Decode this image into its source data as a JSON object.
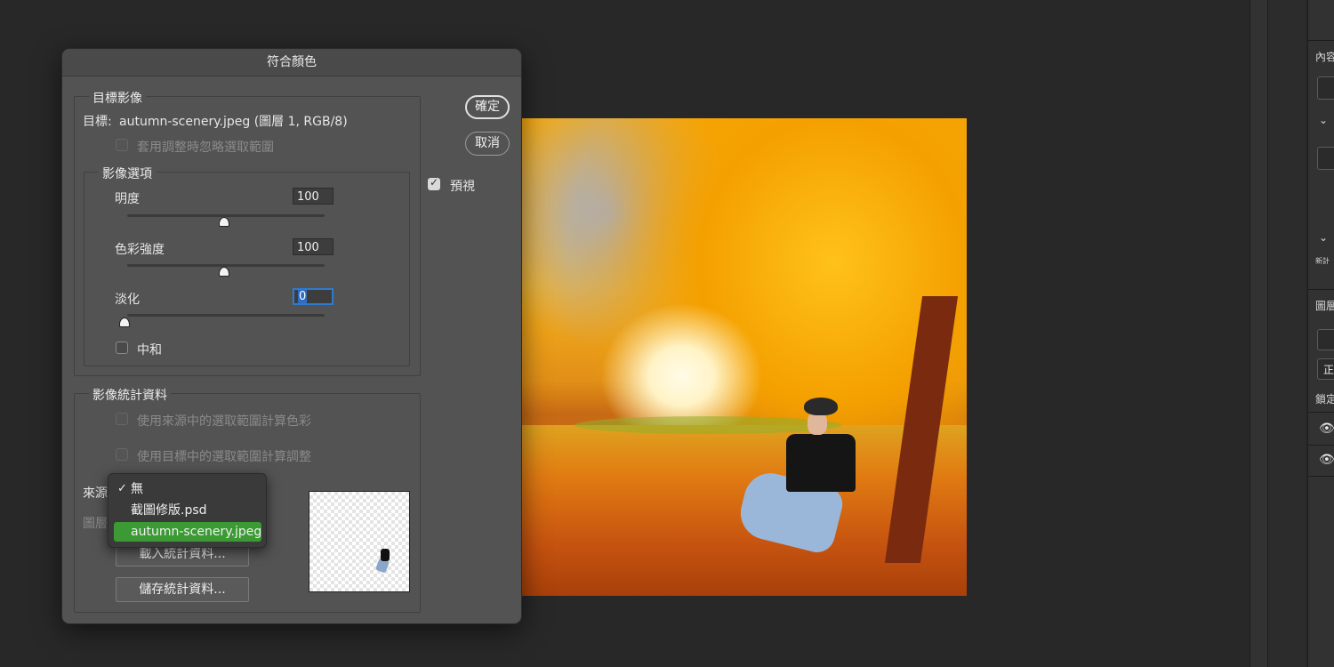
{
  "dialog": {
    "title": "符合顏色",
    "target_image": {
      "group_title": "目標影像",
      "target_label": "目標:",
      "target_value": "autumn-scenery.jpeg (圖層 1, RGB/8)",
      "ignore_selection_label": "套用調整時忽略選取範圍"
    },
    "image_options": {
      "group_title": "影像選項",
      "luminance_label": "明度",
      "luminance_value": "100",
      "color_intensity_label": "色彩強度",
      "color_intensity_value": "100",
      "fade_label": "淡化",
      "fade_value": "0",
      "neutralize_label": "中和",
      "luminance_level": 0.5,
      "color_intensity_level": 0.5,
      "fade_level": 0.0
    },
    "image_statistics": {
      "group_title": "影像統計資料",
      "use_source_selection_label": "使用來源中的選取範圍計算色彩",
      "use_target_selection_label": "使用目標中的選取範圍計算調整",
      "source_label": "來源",
      "layer_label": "圖層",
      "load_stats_label": "載入統計資料...",
      "save_stats_label": "儲存統計資料..."
    },
    "ok_label": "確定",
    "cancel_label": "取消",
    "preview_label": "預視",
    "preview_checked": true
  },
  "source_dropdown": {
    "options": [
      {
        "label": "無",
        "checked": true
      },
      {
        "label": "截圖修版.psd",
        "checked": false
      },
      {
        "label": "autumn-scenery.jpeg",
        "checked": false,
        "highlighted": true
      }
    ],
    "check_mark": "✓",
    "highlight_color": "#3c9a35"
  },
  "right_panel": {
    "properties_label": "內容",
    "layers_label": "圖層",
    "normal_label": "正",
    "lock_label": "鎖定",
    "misc_label": "新計"
  },
  "colors": {
    "dialog_bg": "#535353",
    "app_bg": "#282828",
    "focus_blue": "#2e7ad1"
  }
}
